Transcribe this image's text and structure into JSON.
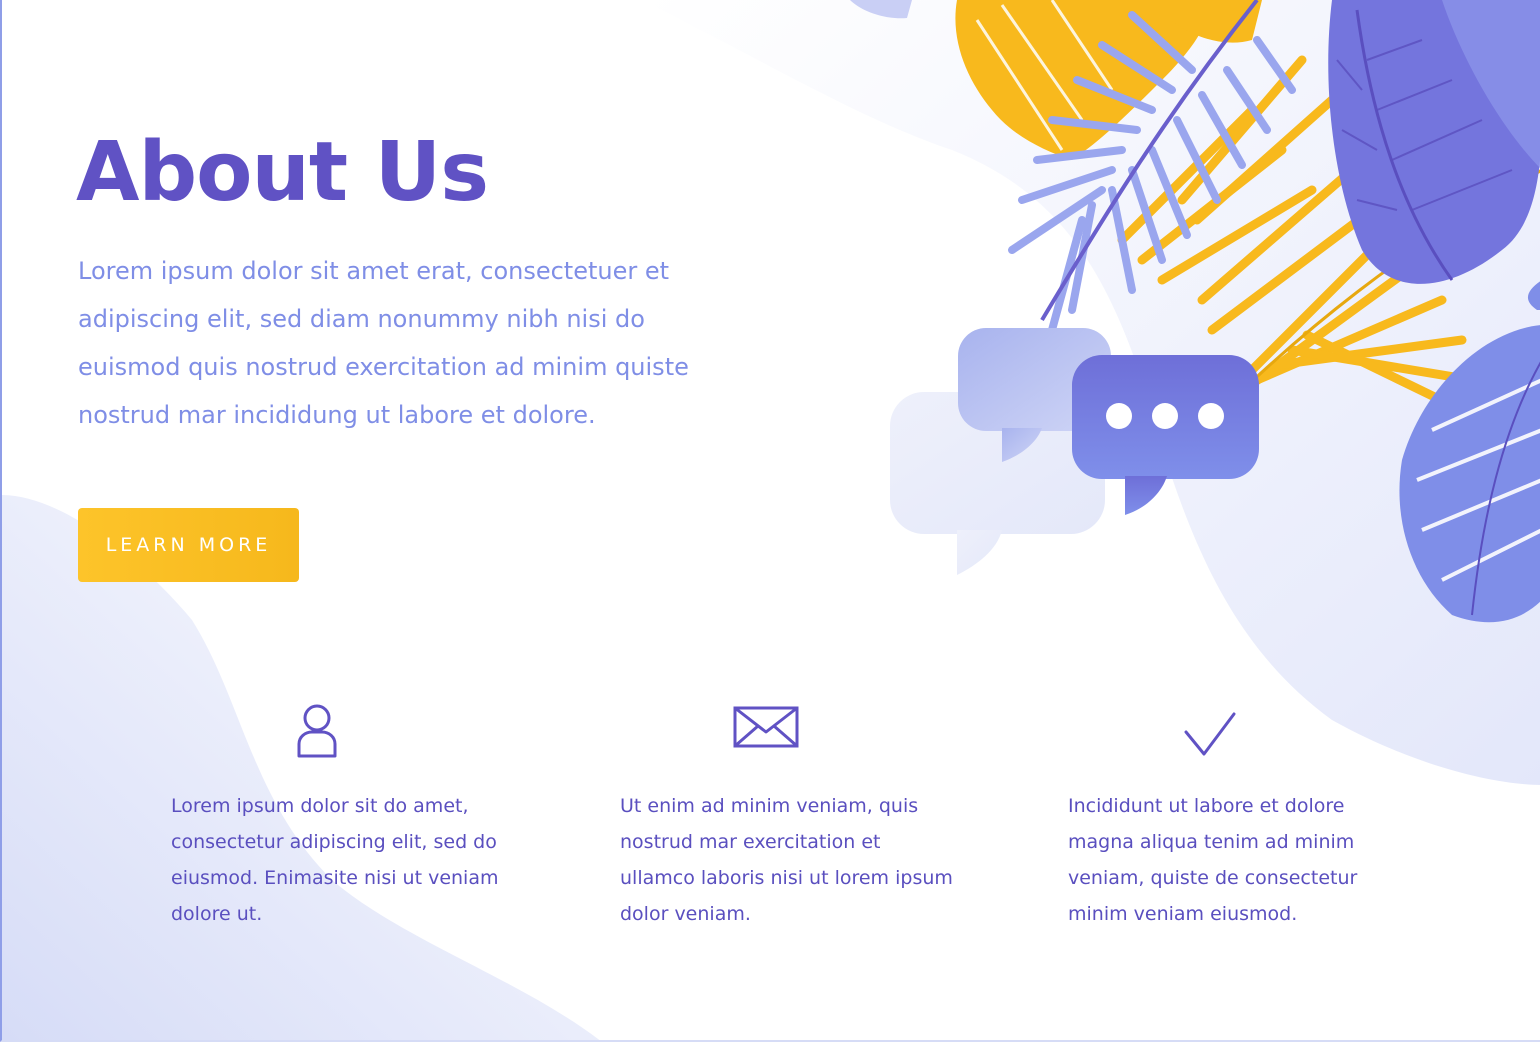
{
  "hero": {
    "title": "About Us",
    "text": "Lorem ipsum dolor sit amet erat, consectetuer et adipiscing elit, sed diam nonummy nibh nisi do euismod quis nostrud exercitation ad minim quiste nostrud mar incididung ut labore et dolore.",
    "button_label": "LEARN MORE"
  },
  "features": [
    {
      "icon": "user-icon",
      "text": "Lorem ipsum dolor sit do amet, consectetur adipiscing elit, sed do eiusmod. Enimasite nisi ut veniam dolore ut."
    },
    {
      "icon": "envelope-icon",
      "text": "Ut enim ad minim veniam, quis nostrud mar exercitation et ullamco laboris nisi ut lorem ipsum dolor veniam."
    },
    {
      "icon": "checkmark-icon",
      "text": "Incididunt ut labore et dolore magna aliqua tenim ad minim veniam, quiste de consectetur minim veniam eiusmod."
    }
  ],
  "colors": {
    "primary": "#6052c4",
    "text_light": "#7f8ee6",
    "accent": "#fbbf22",
    "leaf_blue": "#7d86e6",
    "leaf_yellow": "#f8b91d"
  }
}
